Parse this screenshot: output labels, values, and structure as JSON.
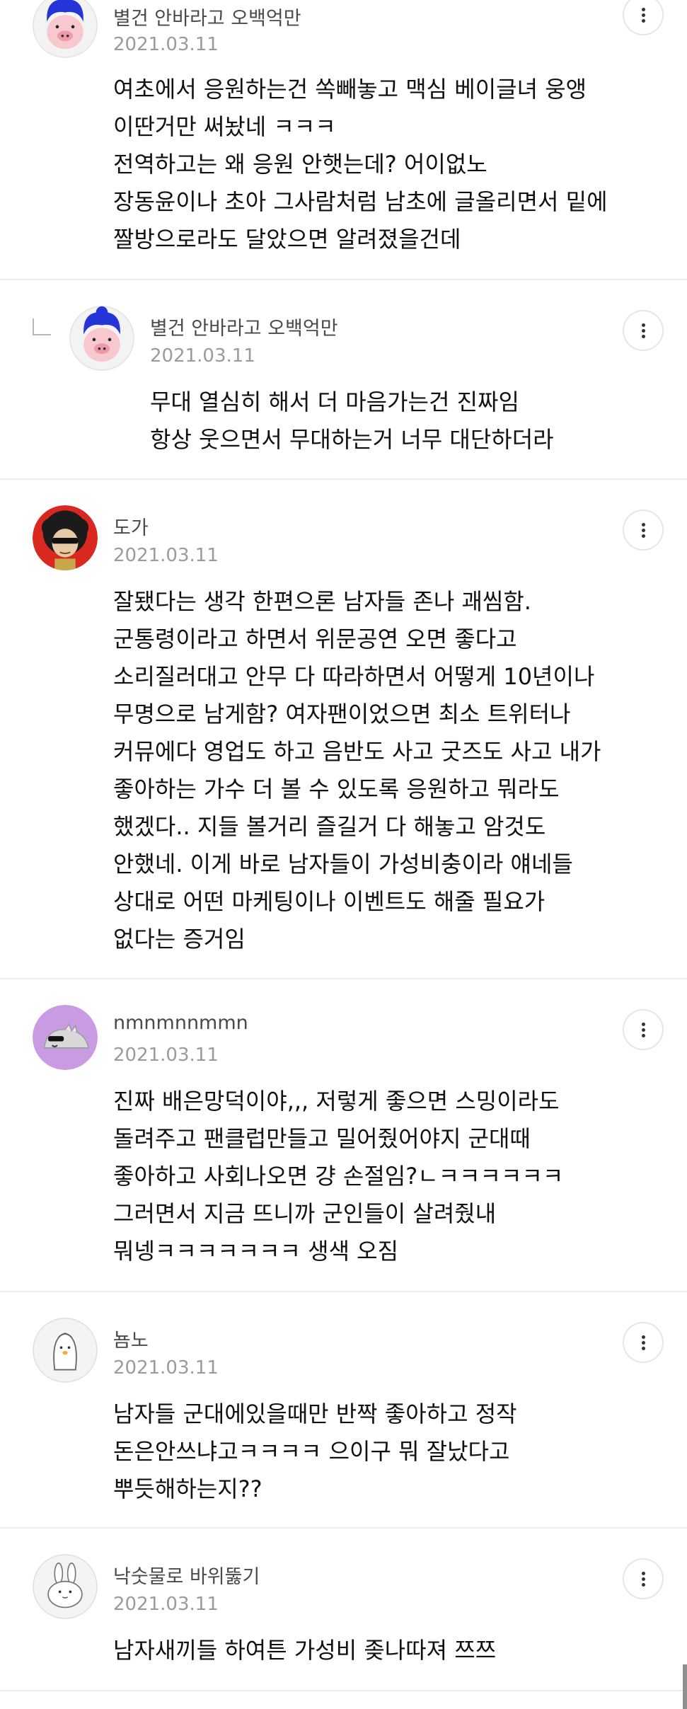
{
  "comments": [
    {
      "nick": "별건 안바라고 오백억만",
      "date": "2021.03.11",
      "avatar": "blue-hair-pig-avatar",
      "lines": [
        "여초에서 응원하는건 쏙빼놓고 맥심 베이글녀 웅앵",
        "이딴거만 써놨네 ㅋㅋㅋ",
        "전역하고는 왜 응원 안햇는데? 어이없노",
        "장동윤이나 초아 그사람처럼 남초에 글올리면서 밑에",
        "짤방으로라도 달았으면 알려졌을건데"
      ]
    },
    {
      "nick": "별건 안바라고 오백억만",
      "date": "2021.03.11",
      "avatar": "blue-hair-pig-avatar",
      "reply": true,
      "lines": [
        "무대 열심히 해서 더 마음가는건 진짜임",
        "항상 웃으면서 무대하는거 너무 대단하더라"
      ]
    },
    {
      "nick": "도가",
      "date": "2021.03.11",
      "avatar": "afro-sunglasses-avatar",
      "lines": [
        "잘됐다는 생각 한편으론 남자들 존나 괘씸함.",
        "군통령이라고 하면서 위문공연 오면 좋다고",
        "소리질러대고 안무 다 따라하면서 어떻게 10년이나",
        "무명으로 남게함? 여자팬이었으면 최소 트위터나",
        "커뮤에다 영업도 하고 음반도 사고 굿즈도 사고 내가",
        "좋아하는 가수 더 볼 수 있도록 응원하고 뭐라도",
        "했겠다.. 지들 볼거리 즐길거 다 해놓고 암것도",
        "안했네. 이게 바로 남자들이 가성비충이라 얘네들",
        "상대로 어떤 마케팅이나 이벤트도 해줄 필요가",
        "없다는 증거임"
      ]
    },
    {
      "nick": "nmnmnnmmn",
      "date": "2021.03.11",
      "avatar": "purple-creature-avatar",
      "lines": [
        "진짜 배은망덕이야,,, 저렇게 좋으면 스밍이라도",
        "돌려주고 팬클럽만들고 밀어줬어야지 군대때",
        "좋아하고 사회나오면 걍 손절임?ㄴㅋㅋㅋㅋㅋㅋ",
        "그러면서 지금 뜨니까 군인들이 살려줬내",
        "뭐넹ㅋㅋㅋㅋㅋㅋㅋ 생색 오짐"
      ]
    },
    {
      "nick": "뇸노",
      "date": "2021.03.11",
      "avatar": "penguin-avatar",
      "lines": [
        "남자들 군대에있을때만 반짝 좋아하고 정작",
        "돈은안쓰냐고ㅋㅋㅋㅋ 으이구 뭐 잘났다고",
        "뿌듯해하는지??"
      ]
    },
    {
      "nick": "낙숫물로 바위뚫기",
      "date": "2021.03.11",
      "avatar": "rabbit-avatar",
      "lines": [
        "남자새끼들 하여튼 가성비 좆나따져 쯔쯔"
      ]
    }
  ],
  "more_icon": "more-vertical-icon",
  "reply_icon": "reply-indent-icon"
}
